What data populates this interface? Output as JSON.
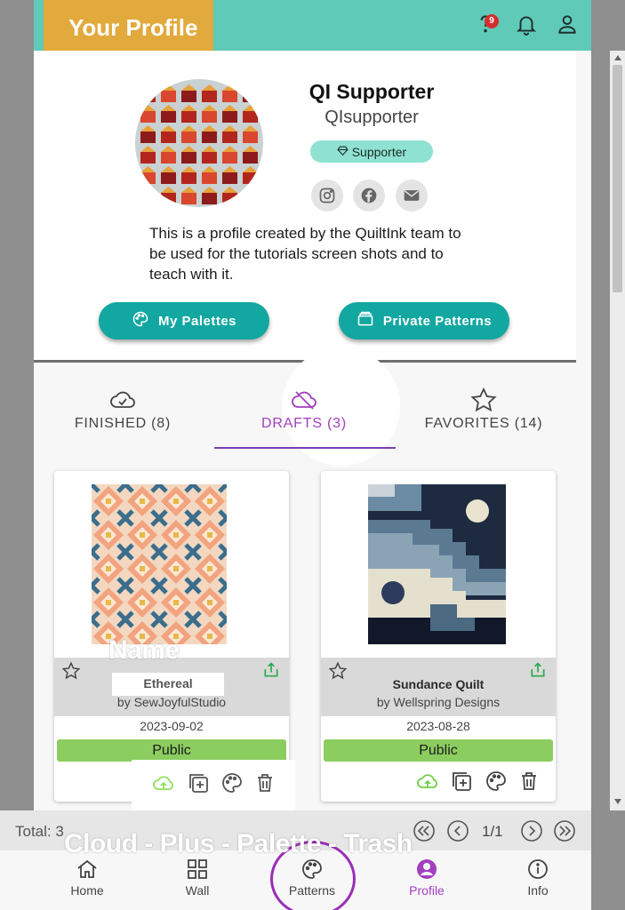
{
  "header": {
    "title": "Your Profile",
    "notification_count": "9"
  },
  "profile": {
    "display_name": "QI Supporter",
    "username": "QIsupporter",
    "badge": "Supporter",
    "bio": "This is a profile created by the QuiltInk team to be used for the tutorials screen shots and to teach with it.",
    "social": [
      "instagram-icon",
      "facebook-icon",
      "email-icon"
    ],
    "buttons": {
      "palettes": "My Palettes",
      "private_patterns": "Private Patterns"
    }
  },
  "tabs": [
    {
      "label": "FINISHED (8)",
      "icon": "cloud-check-icon",
      "active": false
    },
    {
      "label": "DRAFTS (3)",
      "icon": "cloud-off-icon",
      "active": true
    },
    {
      "label": "FAVORITES (14)",
      "icon": "star-icon",
      "active": false
    }
  ],
  "patterns": [
    {
      "name": "Ethereal",
      "author": "by SewJoyfulStudio",
      "date": "2023-09-02",
      "visibility": "Public"
    },
    {
      "name": "Sundance Quilt",
      "author": "by Wellspring Designs",
      "date": "2023-08-28",
      "visibility": "Public"
    }
  ],
  "pagination": {
    "total": "Total: 3",
    "page": "1/1"
  },
  "nav": [
    "Home",
    "Wall",
    "Patterns",
    "Profile",
    "Info"
  ],
  "nav_active": "Profile",
  "annotations": {
    "name": "Name",
    "actions": "Cloud - Plus - Palette - Trash"
  },
  "colors": {
    "header": "#5fcab8",
    "title_bg": "#e2a93c",
    "accent": "#13a7a1",
    "active": "#a23fbf",
    "public": "#8ccd60"
  }
}
